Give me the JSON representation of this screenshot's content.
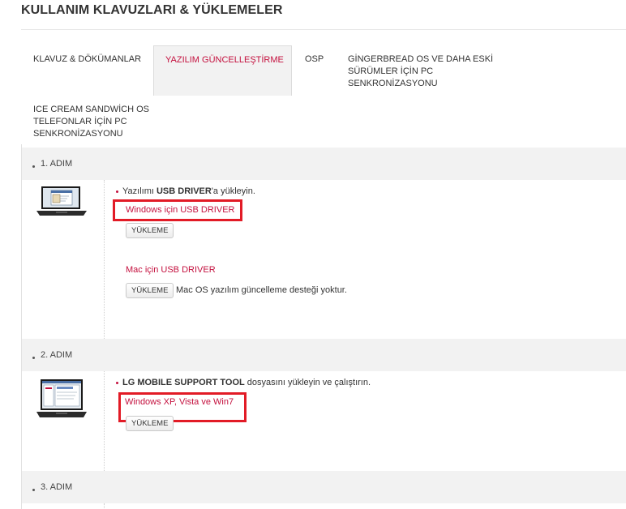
{
  "page": {
    "title": "KULLANIM KLAVUZLARI & YÜKLEMELER"
  },
  "tabs": [
    {
      "lines": [
        "KLAVUZ & DÖKÜMANLAR"
      ]
    },
    {
      "lines": [
        "YAZILIM GÜNCELLEŞTİRME"
      ]
    },
    {
      "lines": [
        "OSP"
      ]
    },
    {
      "lines": [
        "GİNGERBREAD OS VE DAHA ESKİ",
        "SÜRÜMLER İÇİN PC",
        "SENKRONİZASYONU"
      ]
    },
    {
      "lines": [
        "ICE CREAM SANDWİCH OS",
        "TELEFONLAR İÇİN PC",
        "SENKRONİZASYONU"
      ]
    }
  ],
  "steps": [
    {
      "label": "1. ADIM",
      "instruction_prefix": "Yazılımı ",
      "instruction_bold": "USB DRIVER",
      "instruction_suffix": "'a yükleyin.",
      "link1": "Windows için USB DRIVER",
      "button1": "YÜKLEME",
      "link2": "Mac için USB DRIVER",
      "button2": "YÜKLEME",
      "note": "Mac OS yazılım güncelleme desteği yoktur."
    },
    {
      "label": "2. ADIM",
      "instruction_bold": "LG MOBILE SUPPORT TOOL",
      "instruction_suffix": " dosyasını yükleyin ve çalıştırın.",
      "link1": "Windows XP, Vista ve Win7",
      "button1": "YÜKLEME"
    },
    {
      "label": "3. ADIM"
    }
  ],
  "colors": {
    "accent": "#c4103e",
    "highlight": "#e21b26",
    "header_bg": "#f2f2f2"
  }
}
